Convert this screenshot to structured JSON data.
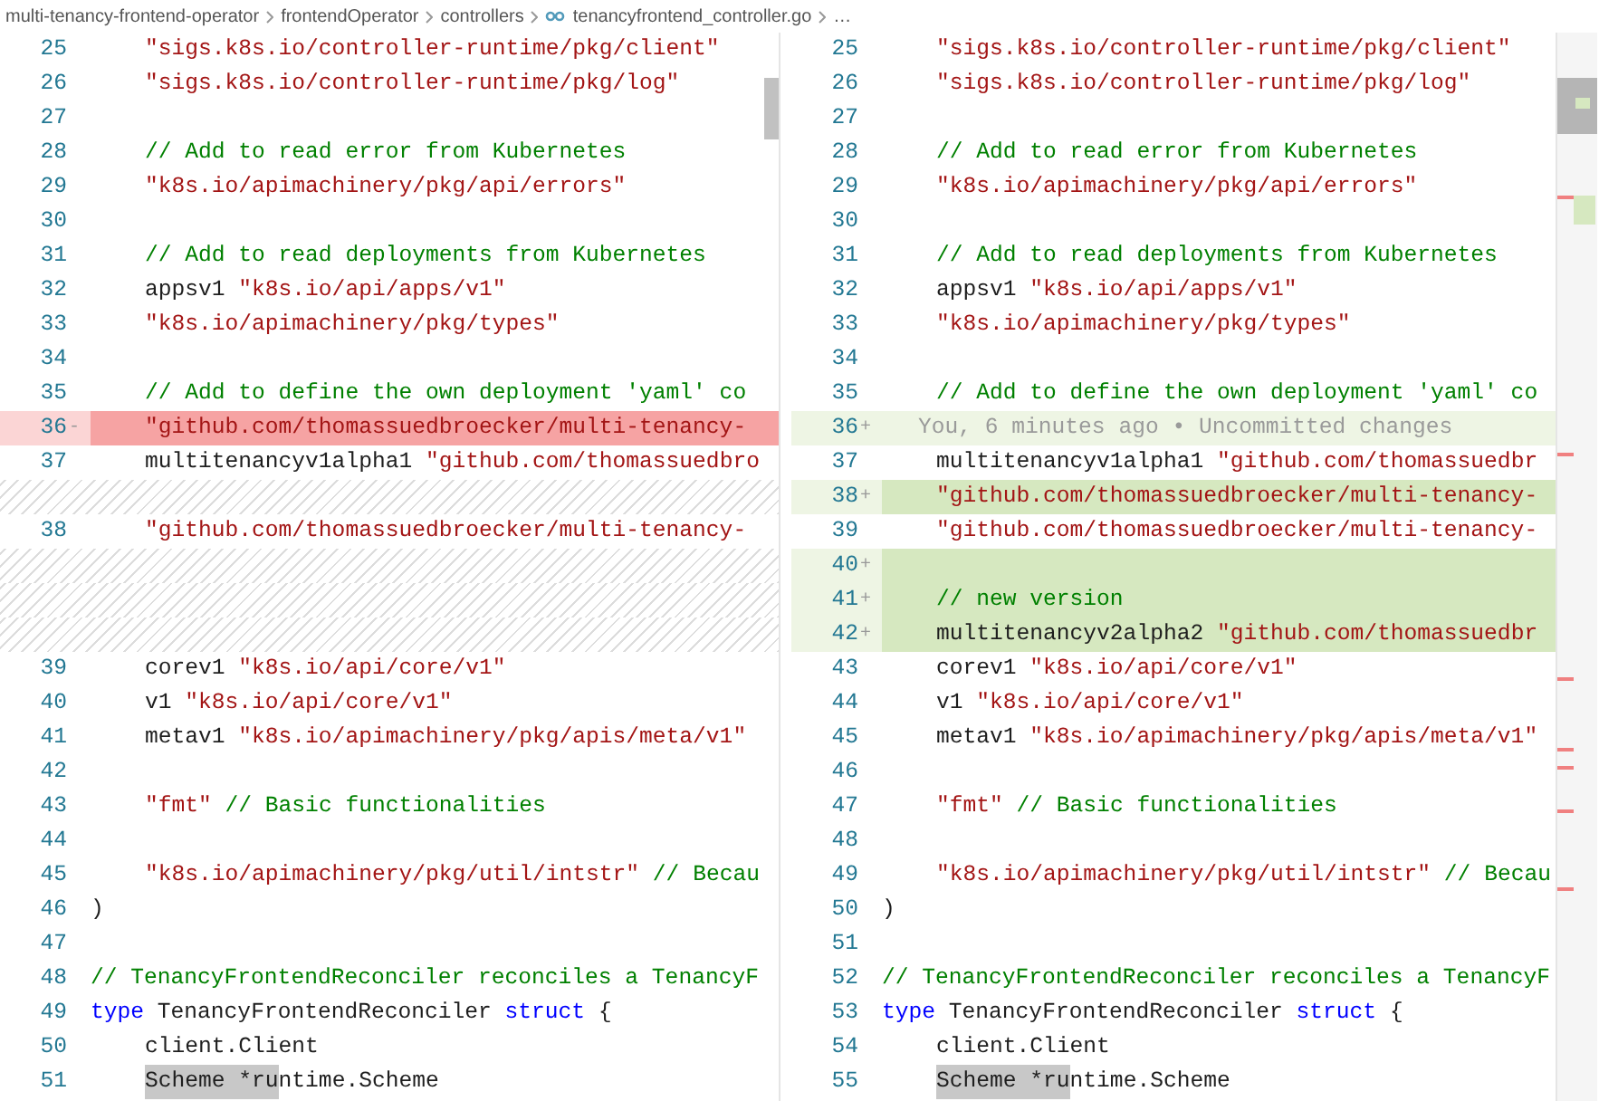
{
  "breadcrumb": [
    {
      "label": "multi-tenancy-frontend-operator",
      "kind": "folder"
    },
    {
      "label": "frontendOperator",
      "kind": "folder"
    },
    {
      "label": "controllers",
      "kind": "folder"
    },
    {
      "label": "tenancyfrontend_controller.go",
      "kind": "file"
    },
    {
      "label": "…",
      "kind": "symbol"
    }
  ],
  "panes": [
    {
      "lines": [
        {
          "kind": "code",
          "number": "25",
          "added": false,
          "deleted": false,
          "indent": true,
          "tokens": [
            {
              "kind": "string",
              "s": "\"sigs.k8s.io/controller-runtime/pkg/client\""
            }
          ]
        },
        {
          "kind": "code",
          "number": "26",
          "added": false,
          "deleted": false,
          "indent": true,
          "tokens": [
            {
              "kind": "string",
              "s": "\"sigs.k8s.io/controller-runtime/pkg/log\""
            }
          ]
        },
        {
          "kind": "code",
          "number": "27",
          "added": false,
          "deleted": false
        },
        {
          "kind": "code",
          "number": "28",
          "added": false,
          "deleted": false,
          "indent": true,
          "tokens": [
            {
              "kind": "comment",
              "s": "// Add to read error from Kubernetes"
            }
          ]
        },
        {
          "kind": "code",
          "number": "29",
          "added": false,
          "deleted": false,
          "indent": true,
          "tokens": [
            {
              "kind": "string",
              "s": "\"k8s.io/apimachinery/pkg/api/errors\""
            }
          ]
        },
        {
          "kind": "code",
          "number": "30",
          "added": false,
          "deleted": false
        },
        {
          "kind": "code",
          "number": "31",
          "added": false,
          "deleted": false,
          "indent": true,
          "tokens": [
            {
              "kind": "comment",
              "s": "// Add to read deployments from Kubernetes"
            }
          ]
        },
        {
          "kind": "code",
          "number": "32",
          "added": false,
          "deleted": false,
          "indent": true,
          "tokens": [
            {
              "kind": "plain",
              "s": "appsv1 "
            },
            {
              "kind": "string",
              "s": "\"k8s.io/api/apps/v1\""
            }
          ]
        },
        {
          "kind": "code",
          "number": "33",
          "added": false,
          "deleted": false,
          "indent": true,
          "tokens": [
            {
              "kind": "string",
              "s": "\"k8s.io/apimachinery/pkg/types\""
            }
          ]
        },
        {
          "kind": "code",
          "number": "34",
          "added": false,
          "deleted": false
        },
        {
          "kind": "code",
          "number": "35",
          "added": false,
          "deleted": false,
          "indent": true,
          "tokens": [
            {
              "kind": "comment",
              "s": "// Add to define the own deployment 'yaml' co"
            }
          ]
        },
        {
          "kind": "code",
          "number": "36",
          "marker": "-",
          "added": false,
          "deleted": true,
          "indent": true,
          "tokens": [
            {
              "kind": "string",
              "s": "\"github.com/thomassuedbroecker/multi-tenancy-"
            }
          ]
        },
        {
          "kind": "code",
          "number": "37",
          "added": false,
          "deleted": false,
          "indent": true,
          "tokens": [
            {
              "kind": "plain",
              "s": "multitenancyv1alpha1 "
            },
            {
              "kind": "string",
              "s": "\"github.com/thomassuedbro"
            }
          ]
        },
        {
          "kind": "filler"
        },
        {
          "kind": "code",
          "number": "38",
          "added": false,
          "deleted": false,
          "indent": true,
          "tokens": [
            {
              "kind": "string",
              "s": "\"github.com/thomassuedbroecker/multi-tenancy-"
            }
          ]
        },
        {
          "kind": "filler"
        },
        {
          "kind": "filler"
        },
        {
          "kind": "filler"
        },
        {
          "kind": "code",
          "number": "39",
          "added": false,
          "deleted": false,
          "indent": true,
          "tokens": [
            {
              "kind": "plain",
              "s": "corev1 "
            },
            {
              "kind": "string",
              "s": "\"k8s.io/api/core/v1\""
            }
          ]
        },
        {
          "kind": "code",
          "number": "40",
          "added": false,
          "deleted": false,
          "indent": true,
          "tokens": [
            {
              "kind": "plain",
              "s": "v1 "
            },
            {
              "kind": "string",
              "s": "\"k8s.io/api/core/v1\""
            }
          ]
        },
        {
          "kind": "code",
          "number": "41",
          "added": false,
          "deleted": false,
          "indent": true,
          "tokens": [
            {
              "kind": "plain",
              "s": "metav1 "
            },
            {
              "kind": "string",
              "s": "\"k8s.io/apimachinery/pkg/apis/meta/v1\""
            }
          ]
        },
        {
          "kind": "code",
          "number": "42",
          "added": false,
          "deleted": false
        },
        {
          "kind": "code",
          "number": "43",
          "added": false,
          "deleted": false,
          "indent": true,
          "tokens": [
            {
              "kind": "string",
              "s": "\"fmt\""
            },
            {
              "kind": "comment",
              "s": " // Basic functionalities"
            }
          ]
        },
        {
          "kind": "code",
          "number": "44",
          "added": false,
          "deleted": false
        },
        {
          "kind": "code",
          "number": "45",
          "added": false,
          "deleted": false,
          "indent": true,
          "tokens": [
            {
              "kind": "string",
              "s": "\"k8s.io/apimachinery/pkg/util/intstr\""
            },
            {
              "kind": "comment",
              "s": " // Becau"
            }
          ]
        },
        {
          "kind": "code",
          "number": "46",
          "added": false,
          "deleted": false,
          "indent": false,
          "tokens": [
            {
              "kind": "plain",
              "s": ")"
            }
          ]
        },
        {
          "kind": "code",
          "number": "47",
          "added": false,
          "deleted": false
        },
        {
          "kind": "code",
          "number": "48",
          "added": false,
          "deleted": false,
          "indent": false,
          "tokens": [
            {
              "kind": "comment",
              "s": "// TenancyFrontendReconciler reconciles a TenancyF"
            }
          ]
        },
        {
          "kind": "code",
          "number": "49",
          "added": false,
          "deleted": false,
          "indent": false,
          "tokens": [
            {
              "kind": "keyword",
              "s": "type"
            },
            {
              "kind": "plain",
              "s": " TenancyFrontendReconciler "
            },
            {
              "kind": "keyword",
              "s": "struct"
            },
            {
              "kind": "plain",
              "s": " {"
            }
          ]
        },
        {
          "kind": "code",
          "number": "50",
          "added": false,
          "deleted": false,
          "indent": true,
          "tokens": [
            {
              "kind": "plain",
              "s": "client.Client"
            }
          ]
        },
        {
          "kind": "code",
          "number": "51",
          "added": false,
          "deleted": false,
          "indent": true,
          "tokens": [
            {
              "kind": "selection",
              "s": "Scheme *ru"
            },
            {
              "kind": "plain",
              "s": "ntime.Scheme"
            }
          ]
        }
      ]
    },
    {
      "lines": [
        {
          "kind": "code",
          "number": "25",
          "added": false,
          "deleted": false,
          "indent": true,
          "tokens": [
            {
              "kind": "string",
              "s": "\"sigs.k8s.io/controller-runtime/pkg/client\""
            }
          ]
        },
        {
          "kind": "code",
          "number": "26",
          "added": false,
          "deleted": false,
          "indent": true,
          "tokens": [
            {
              "kind": "string",
              "s": "\"sigs.k8s.io/controller-runtime/pkg/log\""
            }
          ]
        },
        {
          "kind": "code",
          "number": "27",
          "added": false,
          "deleted": false
        },
        {
          "kind": "code",
          "number": "28",
          "added": false,
          "deleted": false,
          "indent": true,
          "tokens": [
            {
              "kind": "comment",
              "s": "// Add to read error from Kubernetes"
            }
          ]
        },
        {
          "kind": "code",
          "number": "29",
          "added": false,
          "deleted": false,
          "indent": true,
          "tokens": [
            {
              "kind": "string",
              "s": "\"k8s.io/apimachinery/pkg/api/errors\""
            }
          ]
        },
        {
          "kind": "code",
          "number": "30",
          "added": false,
          "deleted": false
        },
        {
          "kind": "code",
          "number": "31",
          "added": false,
          "deleted": false,
          "indent": true,
          "tokens": [
            {
              "kind": "comment",
              "s": "// Add to read deployments from Kubernetes"
            }
          ]
        },
        {
          "kind": "code",
          "number": "32",
          "added": false,
          "deleted": false,
          "indent": true,
          "tokens": [
            {
              "kind": "plain",
              "s": "appsv1 "
            },
            {
              "kind": "string",
              "s": "\"k8s.io/api/apps/v1\""
            }
          ]
        },
        {
          "kind": "code",
          "number": "33",
          "added": false,
          "deleted": false,
          "indent": true,
          "tokens": [
            {
              "kind": "string",
              "s": "\"k8s.io/apimachinery/pkg/types\""
            }
          ]
        },
        {
          "kind": "code",
          "number": "34",
          "added": false,
          "deleted": false
        },
        {
          "kind": "code",
          "number": "35",
          "added": false,
          "deleted": false,
          "indent": true,
          "tokens": [
            {
              "kind": "comment",
              "s": "// Add to define the own deployment 'yaml' co"
            }
          ]
        },
        {
          "kind": "code",
          "number": "36",
          "marker": "+",
          "added": true,
          "deleted": false,
          "highlight": false,
          "annotation": "You, 6 minutes ago • Uncommitted changes"
        },
        {
          "kind": "code",
          "number": "37",
          "added": false,
          "deleted": false,
          "indent": true,
          "tokens": [
            {
              "kind": "plain",
              "s": "multitenancyv1alpha1 "
            },
            {
              "kind": "string",
              "s": "\"github.com/thomassuedbr"
            }
          ]
        },
        {
          "kind": "code",
          "number": "38",
          "marker": "+",
          "added": true,
          "deleted": false,
          "highlight": true,
          "indent": true,
          "tokens": [
            {
              "kind": "string",
              "s": "\"github.com/thomassuedbroecker/multi-tenancy-"
            }
          ]
        },
        {
          "kind": "code",
          "number": "39",
          "added": false,
          "deleted": false,
          "indent": true,
          "tokens": [
            {
              "kind": "string",
              "s": "\"github.com/thomassuedbroecker/multi-tenancy-"
            }
          ]
        },
        {
          "kind": "code",
          "number": "40",
          "marker": "+",
          "added": true,
          "deleted": false,
          "highlight": true
        },
        {
          "kind": "code",
          "number": "41",
          "marker": "+",
          "added": true,
          "deleted": false,
          "highlight": true,
          "indent": true,
          "tokens": [
            {
              "kind": "comment",
              "s": "// new version"
            }
          ]
        },
        {
          "kind": "code",
          "number": "42",
          "marker": "+",
          "added": true,
          "deleted": false,
          "highlight": true,
          "indent": true,
          "tokens": [
            {
              "kind": "plain",
              "s": "multitenancyv2alpha2 "
            },
            {
              "kind": "string",
              "s": "\"github.com/thomassuedbr"
            }
          ]
        },
        {
          "kind": "code",
          "number": "43",
          "added": false,
          "deleted": false,
          "indent": true,
          "tokens": [
            {
              "kind": "plain",
              "s": "corev1 "
            },
            {
              "kind": "string",
              "s": "\"k8s.io/api/core/v1\""
            }
          ]
        },
        {
          "kind": "code",
          "number": "44",
          "added": false,
          "deleted": false,
          "indent": true,
          "tokens": [
            {
              "kind": "plain",
              "s": "v1 "
            },
            {
              "kind": "string",
              "s": "\"k8s.io/api/core/v1\""
            }
          ]
        },
        {
          "kind": "code",
          "number": "45",
          "added": false,
          "deleted": false,
          "indent": true,
          "tokens": [
            {
              "kind": "plain",
              "s": "metav1 "
            },
            {
              "kind": "string",
              "s": "\"k8s.io/apimachinery/pkg/apis/meta/v1\""
            }
          ]
        },
        {
          "kind": "code",
          "number": "46",
          "added": false,
          "deleted": false
        },
        {
          "kind": "code",
          "number": "47",
          "added": false,
          "deleted": false,
          "indent": true,
          "tokens": [
            {
              "kind": "string",
              "s": "\"fmt\""
            },
            {
              "kind": "comment",
              "s": " // Basic functionalities"
            }
          ]
        },
        {
          "kind": "code",
          "number": "48",
          "added": false,
          "deleted": false
        },
        {
          "kind": "code",
          "number": "49",
          "added": false,
          "deleted": false,
          "indent": true,
          "tokens": [
            {
              "kind": "string",
              "s": "\"k8s.io/apimachinery/pkg/util/intstr\""
            },
            {
              "kind": "comment",
              "s": " // Becau"
            }
          ]
        },
        {
          "kind": "code",
          "number": "50",
          "added": false,
          "deleted": false,
          "indent": false,
          "tokens": [
            {
              "kind": "plain",
              "s": ")"
            }
          ]
        },
        {
          "kind": "code",
          "number": "51",
          "added": false,
          "deleted": false
        },
        {
          "kind": "code",
          "number": "52",
          "added": false,
          "deleted": false,
          "indent": false,
          "tokens": [
            {
              "kind": "comment",
              "s": "// TenancyFrontendReconciler reconciles a TenancyF"
            }
          ]
        },
        {
          "kind": "code",
          "number": "53",
          "added": false,
          "deleted": false,
          "indent": false,
          "tokens": [
            {
              "kind": "keyword",
              "s": "type"
            },
            {
              "kind": "plain",
              "s": " TenancyFrontendReconciler "
            },
            {
              "kind": "keyword",
              "s": "struct"
            },
            {
              "kind": "plain",
              "s": " {"
            }
          ]
        },
        {
          "kind": "code",
          "number": "54",
          "added": false,
          "deleted": false,
          "indent": true,
          "tokens": [
            {
              "kind": "plain",
              "s": "client.Client"
            }
          ]
        },
        {
          "kind": "code",
          "number": "55",
          "added": false,
          "deleted": false,
          "indent": true,
          "tokens": [
            {
              "kind": "selection",
              "s": "Scheme *ru"
            },
            {
              "kind": "plain",
              "s": "ntime.Scheme"
            }
          ]
        }
      ]
    }
  ]
}
